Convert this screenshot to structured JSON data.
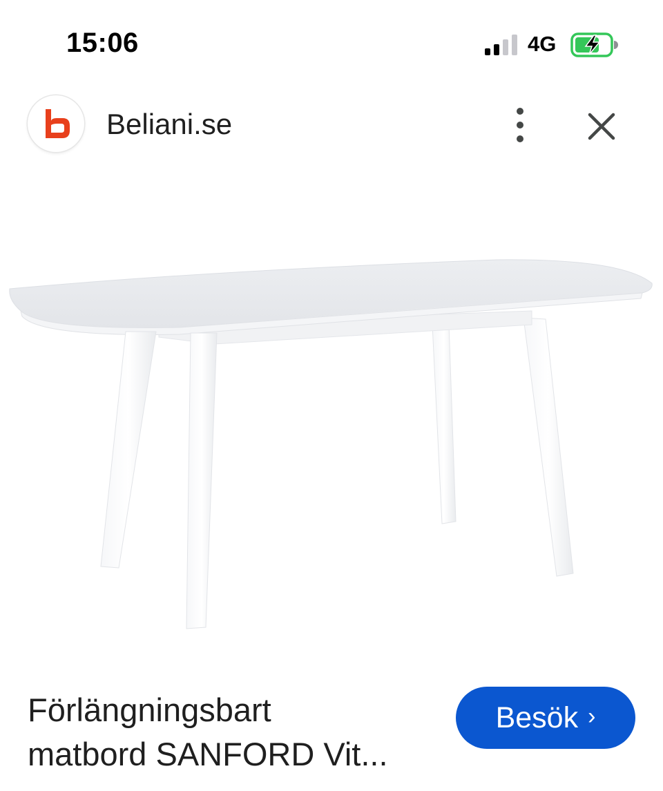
{
  "status_bar": {
    "time": "15:06",
    "network": "4G",
    "signal_icon": "signal-bars-icon",
    "battery_icon": "battery-charging-icon",
    "battery_color": "#34c759"
  },
  "header": {
    "site_name": "Beliani.se",
    "logo_icon": "beliani-logo-icon",
    "logo_color": "#e8401c",
    "more_icon": "more-vertical-icon",
    "close_icon": "close-icon"
  },
  "product": {
    "title_line1": "Förlängningsbart",
    "title_line2": "matbord SANFORD Vit...",
    "visit_label": "Besök",
    "visit_chevron": "›",
    "accent_color": "#0b57d0"
  }
}
